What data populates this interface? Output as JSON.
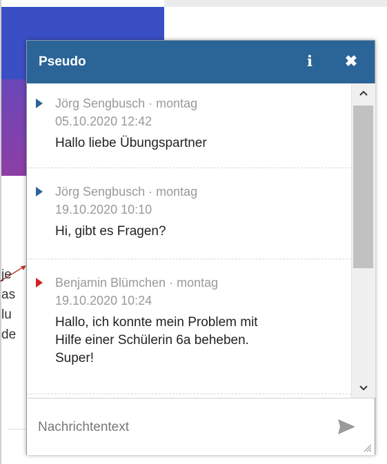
{
  "background_fragments": [
    "je",
    "as",
    "lu",
    "de"
  ],
  "chat": {
    "title": "Pseudo",
    "info_glyph": "i",
    "close_glyph": "✖",
    "messages": [
      {
        "author_date": "Jörg Sengbusch · montag",
        "time": "05.10.2020 12:42",
        "text": "Hallo liebe Übungspartner",
        "marker_color": "#2b6497"
      },
      {
        "author_date": "Jörg Sengbusch · montag",
        "time": "19.10.2020 10:10",
        "text": "Hi, gibt es Fragen?",
        "marker_color": "#2b6497"
      },
      {
        "author_date": "Benjamin Blümchen · montag",
        "time": "19.10.2020 10:24",
        "text_lines": [
          "Hallo, ich konnte mein Problem mit",
          "Hilfe einer Schülerin 6a beheben.",
          "Super!"
        ],
        "marker_color": "#d62020"
      }
    ],
    "composer": {
      "placeholder": "Nachrichtentext",
      "value": ""
    },
    "icons": {
      "info": "info-icon",
      "close": "close-icon",
      "send": "send-icon",
      "scroll_up": "chevron-up-icon",
      "scroll_down": "chevron-down-icon",
      "resize": "resize-grip-icon"
    }
  },
  "colors": {
    "header": "#2b6497",
    "accent_blue": "#3a4fc4",
    "accent_purple": "#8e3ea6"
  }
}
